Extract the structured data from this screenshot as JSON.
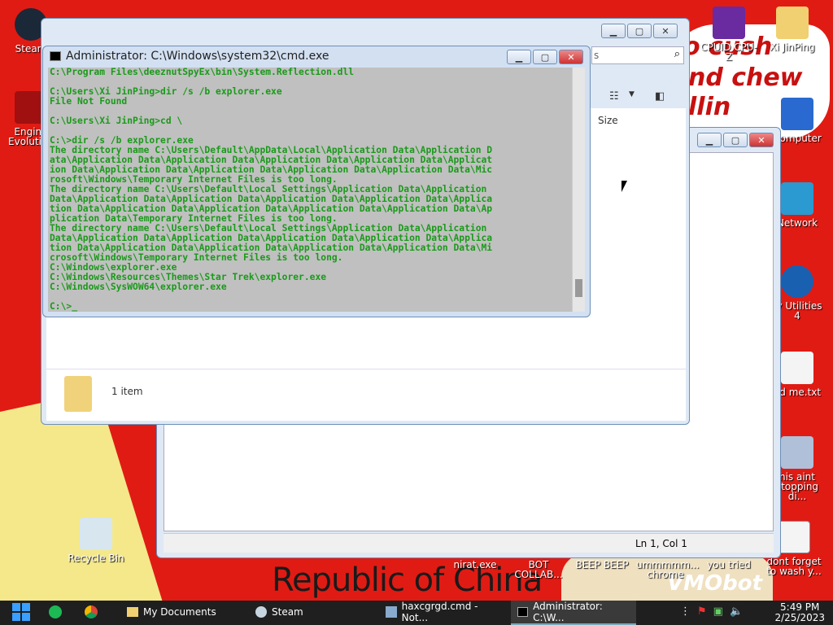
{
  "desktop": {
    "banner_text": "Republic of China",
    "art_text_lines": [
      "o cush",
      "nd chew",
      "llin"
    ],
    "art_text_corner": "VMObot",
    "icons": [
      {
        "label": "Steam"
      },
      {
        "label": "Engine Evolution"
      },
      {
        "label": "Recycle Bin"
      },
      {
        "label": "CPUID CPU-Z"
      },
      {
        "label": "Xi JinPing"
      },
      {
        "label": "Computer"
      },
      {
        "label": "Network"
      },
      {
        "label": "ry Utilities 4"
      },
      {
        "label": "ad me.txt"
      },
      {
        "label": "his aint stopping di..."
      },
      {
        "label": "nirat.exe"
      },
      {
        "label": "BOT COLLAB..."
      },
      {
        "label": "BEEP BEEP"
      },
      {
        "label": "ummmmm... chrome"
      },
      {
        "label": "you tried"
      },
      {
        "label": "dont forget to wash y..."
      }
    ]
  },
  "explorer": {
    "size_column": "Size",
    "item_count": "1 item",
    "search_suffix": "s"
  },
  "notepad": {
    "status_position": "Ln 1, Col 1"
  },
  "cmd": {
    "title": "Administrator: C:\\Windows\\system32\\cmd.exe",
    "lines": [
      "C:\\Program Files\\deeznutSpyEx\\bin\\System.Reflection.dll",
      "",
      "C:\\Users\\Xi JinPing>dir /s /b explorer.exe",
      "File Not Found",
      "",
      "C:\\Users\\Xi JinPing>cd \\",
      "",
      "C:\\>dir /s /b explorer.exe",
      "The directory name C:\\Users\\Default\\AppData\\Local\\Application Data\\Application D",
      "ata\\Application Data\\Application Data\\Application Data\\Application Data\\Applicat",
      "ion Data\\Application Data\\Application Data\\Application Data\\Application Data\\Mic",
      "rosoft\\Windows\\Temporary Internet Files is too long.",
      "The directory name C:\\Users\\Default\\Local Settings\\Application Data\\Application",
      "Data\\Application Data\\Application Data\\Application Data\\Application Data\\Applica",
      "tion Data\\Application Data\\Application Data\\Application Data\\Application Data\\Ap",
      "plication Data\\Temporary Internet Files is too long.",
      "The directory name C:\\Users\\Default\\Local Settings\\Application Data\\Application",
      "Data\\Application Data\\Application Data\\Application Data\\Application Data\\Applica",
      "tion Data\\Application Data\\Application Data\\Application Data\\Application Data\\Mi",
      "crosoft\\Windows\\Temporary Internet Files is too long.",
      "C:\\Windows\\explorer.exe",
      "C:\\Windows\\Resources\\Themes\\Star Trek\\explorer.exe",
      "C:\\Windows\\SysWOW64\\explorer.exe",
      "",
      "C:\\>_"
    ]
  },
  "taskbar": {
    "items": [
      {
        "label": "My Documents"
      },
      {
        "label": "Steam"
      },
      {
        "label": "haxcgrgd.cmd - Not..."
      },
      {
        "label": "Administrator: C:\\W..."
      }
    ],
    "time": "5:49 PM",
    "date": "2/25/2023"
  },
  "colors": {
    "desktop_bg": "#e01b14",
    "cmd_text": "#1a9a1a",
    "cmd_bg": "#c0c0c0",
    "taskbar_bg": "#1f1f1f"
  }
}
